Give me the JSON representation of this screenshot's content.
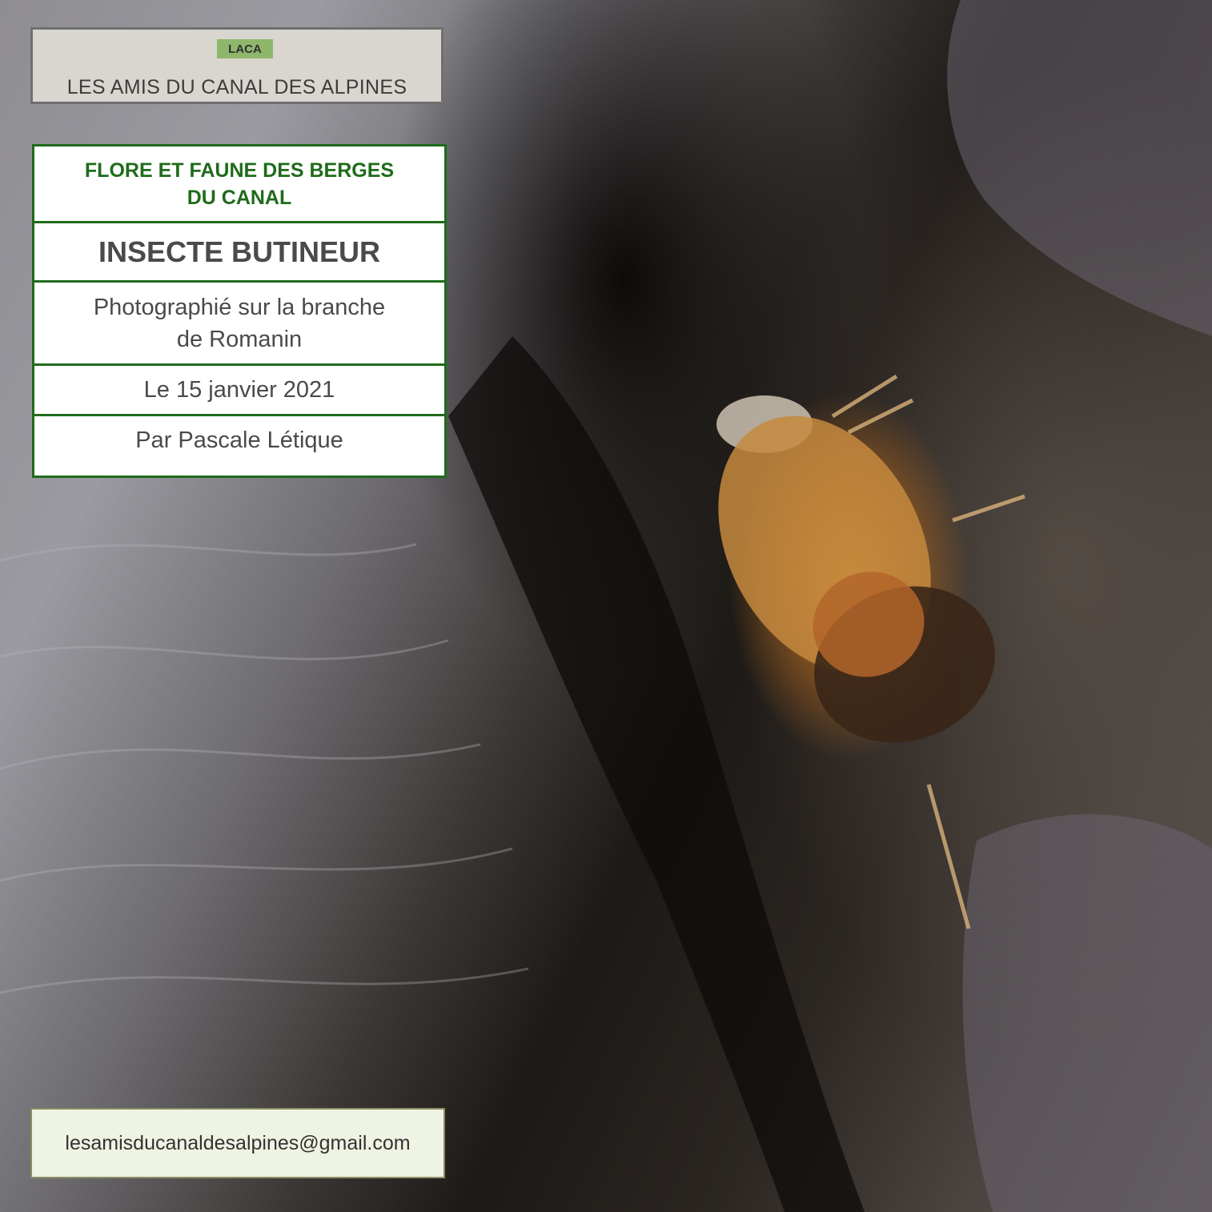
{
  "logo": {
    "badge": "LACA",
    "title": "LES AMIS DU CANAL DES ALPINES"
  },
  "info": {
    "header_line1": "FLORE ET FAUNE DES BERGES",
    "header_line2": "DU CANAL",
    "title": "INSECTE BUTINEUR",
    "location_line1": "Photographié sur la branche",
    "location_line2": "de Romanin",
    "date": "Le 15 janvier 2021",
    "author": "Par Pascale Létique"
  },
  "contact": {
    "email": "lesamisducanaldesalpines@gmail.com"
  },
  "colors": {
    "frame_green": "#1f6b1b",
    "badge_green": "#8fb76b",
    "email_bg": "#eef3e2"
  }
}
